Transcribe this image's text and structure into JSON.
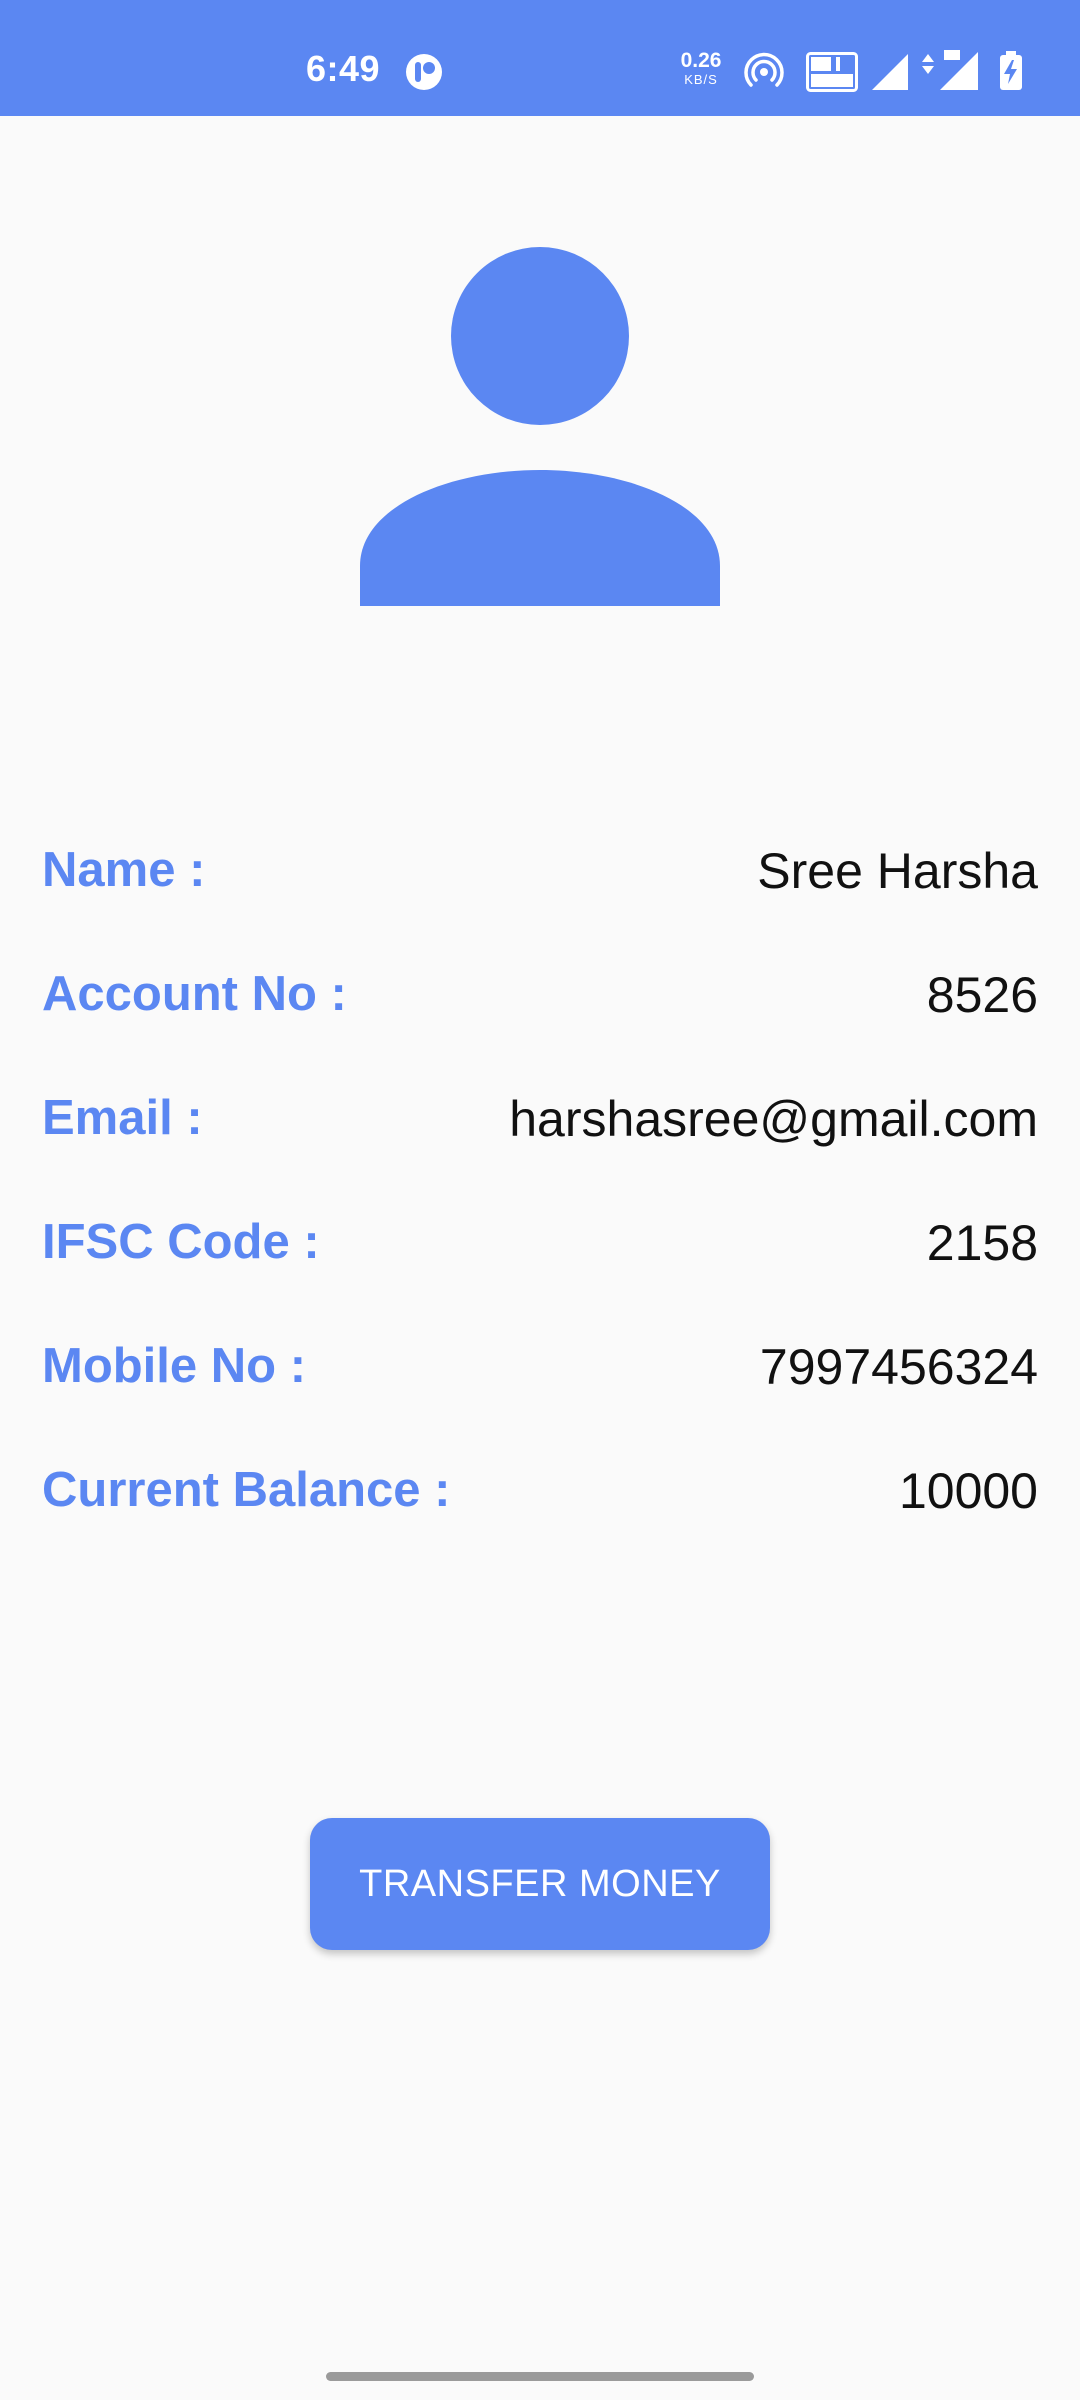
{
  "status_bar": {
    "time": "6:49",
    "net_speed_value": "0.26",
    "net_speed_unit": "KB/S",
    "background_color": "#5b87f2",
    "icons": [
      "app-notification-icon",
      "hotspot-icon",
      "volte-icon",
      "signal-icon",
      "signal-4g-icon",
      "battery-charging-icon"
    ]
  },
  "profile": {
    "avatar_icon": "person-icon",
    "fields": [
      {
        "label": "Name :",
        "value": "Sree Harsha"
      },
      {
        "label": "Account No :",
        "value": "8526"
      },
      {
        "label": "Email :",
        "value": "harshasree@gmail.com"
      },
      {
        "label": "IFSC Code :",
        "value": "2158"
      },
      {
        "label": "Mobile No :",
        "value": "7997456324"
      },
      {
        "label": "Current Balance :",
        "value": "10000"
      }
    ]
  },
  "actions": {
    "transfer_label": "TRANSFER MONEY"
  },
  "colors": {
    "accent": "#5b87f2",
    "background": "#fafafa",
    "value_text": "#111111"
  }
}
